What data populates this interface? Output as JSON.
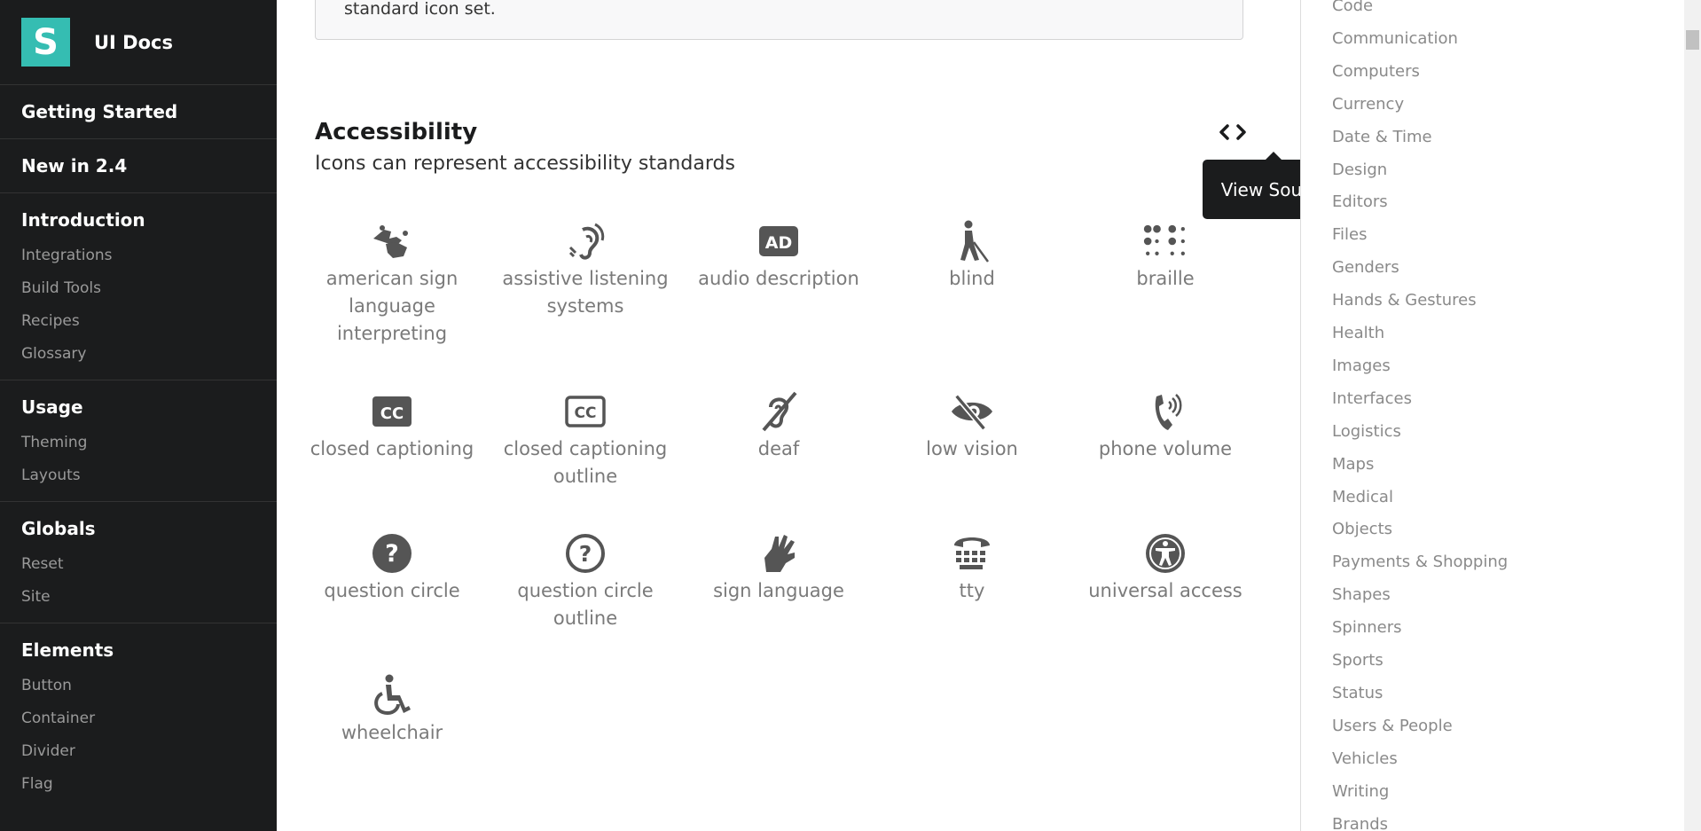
{
  "brand": {
    "logo_letter": "S",
    "name": "UI Docs"
  },
  "sidebar": {
    "getting_started": "Getting Started",
    "new_in": "New in 2.4",
    "introduction": {
      "title": "Introduction",
      "items": [
        "Integrations",
        "Build Tools",
        "Recipes",
        "Glossary"
      ]
    },
    "usage": {
      "title": "Usage",
      "items": [
        "Theming",
        "Layouts"
      ]
    },
    "globals": {
      "title": "Globals",
      "items": [
        "Reset",
        "Site"
      ]
    },
    "elements": {
      "title": "Elements",
      "items": [
        "Button",
        "Container",
        "Divider",
        "Flag"
      ]
    }
  },
  "main": {
    "intro_text": "standard icon set.",
    "section_title": "Accessibility",
    "section_subtitle": "Icons can represent accessibility standards",
    "tooltip": "View Source",
    "icons": [
      {
        "label": "american sign language interpreting",
        "icon": "asl-interpreting-icon"
      },
      {
        "label": "assistive listening systems",
        "icon": "assistive-listening-icon"
      },
      {
        "label": "audio description",
        "icon": "audio-description-icon"
      },
      {
        "label": "blind",
        "icon": "blind-icon"
      },
      {
        "label": "braille",
        "icon": "braille-icon"
      },
      {
        "label": "closed captioning",
        "icon": "closed-captioning-icon"
      },
      {
        "label": "closed captioning outline",
        "icon": "closed-captioning-outline-icon"
      },
      {
        "label": "deaf",
        "icon": "deaf-icon"
      },
      {
        "label": "low vision",
        "icon": "low-vision-icon"
      },
      {
        "label": "phone volume",
        "icon": "phone-volume-icon"
      },
      {
        "label": "question circle",
        "icon": "question-circle-icon"
      },
      {
        "label": "question circle outline",
        "icon": "question-circle-outline-icon"
      },
      {
        "label": "sign language",
        "icon": "sign-language-icon"
      },
      {
        "label": "tty",
        "icon": "tty-icon"
      },
      {
        "label": "universal access",
        "icon": "universal-access-icon"
      },
      {
        "label": "wheelchair",
        "icon": "wheelchair-icon"
      }
    ]
  },
  "rightmenu": {
    "items": [
      "Code",
      "Communication",
      "Computers",
      "Currency",
      "Date & Time",
      "Design",
      "Editors",
      "Files",
      "Genders",
      "Hands & Gestures",
      "Health",
      "Images",
      "Interfaces",
      "Logistics",
      "Maps",
      "Medical",
      "Objects",
      "Payments & Shopping",
      "Shapes",
      "Spinners",
      "Sports",
      "Status",
      "Users & People",
      "Vehicles",
      "Writing",
      "Brands"
    ]
  },
  "colors": {
    "sidebar_bg": "#1b1c1d",
    "logo_bg": "#35bdb2",
    "icon": "#555555",
    "label": "#7a7a7a"
  }
}
